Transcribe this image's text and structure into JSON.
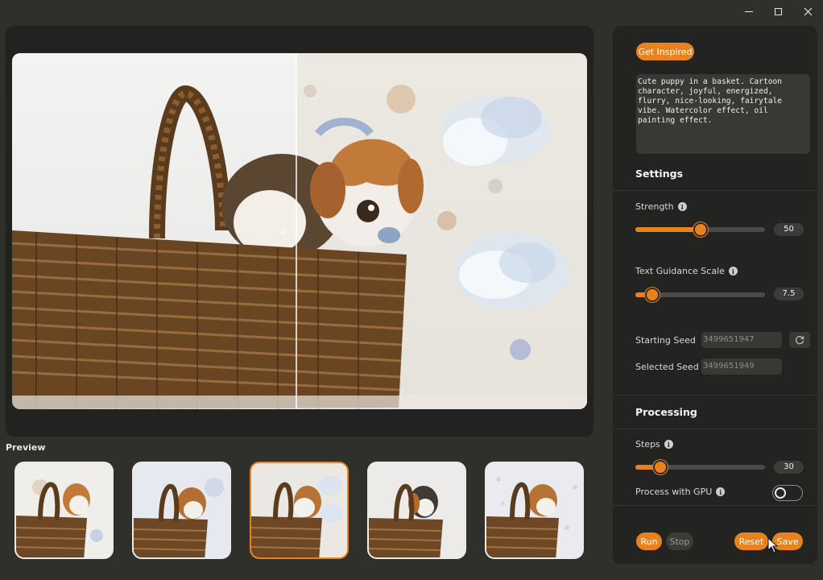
{
  "window": {
    "icons": [
      "minimize-icon",
      "maximize-icon",
      "close-icon"
    ]
  },
  "preview": {
    "label": "Preview",
    "thumbnails": [
      {
        "selected": false
      },
      {
        "selected": false
      },
      {
        "selected": true
      },
      {
        "selected": false
      },
      {
        "selected": false
      }
    ]
  },
  "side": {
    "inspire_label": "Get Inspired",
    "prompt_text": "Cute puppy in a basket. Cartoon\ncharacter, joyful, energized,\nflurry, nice-looking, fairytale\nvibe. Watercolor effect, oil\npainting effect.",
    "settings": {
      "title": "Settings",
      "strength": {
        "label": "Strength",
        "value": "50",
        "fraction": 0.5
      },
      "guidance": {
        "label": "Text Guidance Scale",
        "value": "7.5",
        "fraction": 0.13
      },
      "starting_seed": {
        "label": "Starting Seed",
        "placeholder": "3499651947"
      },
      "selected_seed": {
        "label": "Selected Seed",
        "placeholder": "3499651949"
      }
    },
    "processing": {
      "title": "Processing",
      "steps": {
        "label": "Steps",
        "value": "30",
        "fraction": 0.19
      },
      "gpu": {
        "label": "Process with GPU",
        "enabled": false
      }
    },
    "buttons": {
      "run": "Run",
      "stop": "Stop",
      "reset": "Reset",
      "save": "Save"
    }
  },
  "colors": {
    "accent": "#e8821d",
    "panel": "#232321",
    "background": "#2f2f2c"
  }
}
